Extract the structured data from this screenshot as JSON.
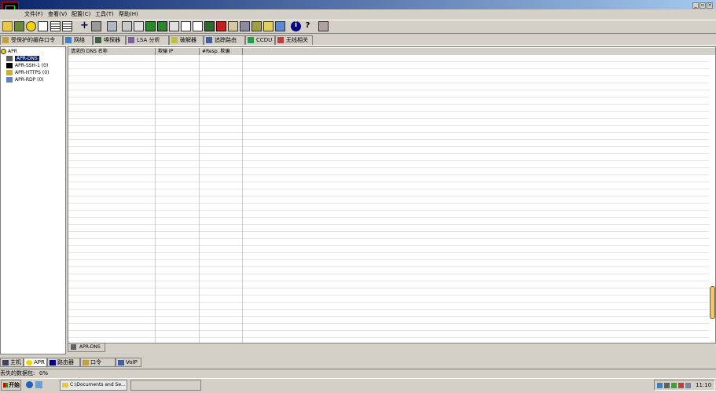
{
  "menubar": {
    "items": [
      "文件(F)",
      "查看(V)",
      "配置(C)",
      "工具(T)",
      "帮助(H)"
    ]
  },
  "toolbar": {
    "icons": [
      "open-icon",
      "save-icon",
      "radioactive-icon",
      "network-icon",
      "grid-icon",
      "list-icon",
      "plus-icon",
      "bin-icon",
      "netgraph-icon",
      "arrow-icon",
      "hash-icon",
      "hash2-icon",
      "wave-icon",
      "chart-icon",
      "dots-icon",
      "mail-icon",
      "card-icon",
      "sheet-icon",
      "cert-icon",
      "lock-icon",
      "db-icon",
      "key-icon",
      "info-icon",
      "question-icon",
      "tower-icon"
    ]
  },
  "main_tabs": [
    {
      "label": "受保护的缓存口令",
      "icon": "key-icon"
    },
    {
      "label": "网络",
      "icon": "network-icon"
    },
    {
      "label": "嗅探器",
      "icon": "sniffer-icon"
    },
    {
      "label": "LSA 分析",
      "icon": "lsa-icon"
    },
    {
      "label": "破解器",
      "icon": "cracker-icon"
    },
    {
      "label": "追踪路由",
      "icon": "traceroute-icon"
    },
    {
      "label": "CCDU",
      "icon": "ccdu-icon"
    },
    {
      "label": "无线相关",
      "icon": "wireless-icon"
    }
  ],
  "tree": {
    "root": "APR",
    "items": [
      {
        "label": "APR-DNS",
        "selected": true
      },
      {
        "label": "APR-SSH-1 (0)"
      },
      {
        "label": "APR-HTTPS (0)"
      },
      {
        "label": "APR-RDP (0)"
      }
    ]
  },
  "table": {
    "columns": [
      "请求的 DNS 名称",
      "欺骗 IP",
      "#Resp. 欺骗",
      ""
    ]
  },
  "inner_tab": {
    "label": "APR-DNS"
  },
  "bottom_tabs": [
    {
      "label": "主机",
      "icon": "host-icon"
    },
    {
      "label": "APR",
      "icon": "radioactive-icon"
    },
    {
      "label": "路由器",
      "icon": "router-icon"
    },
    {
      "label": "口令",
      "icon": "password-icon"
    },
    {
      "label": "VoIP",
      "icon": "voip-icon"
    }
  ],
  "status": {
    "label": "丢失的数据包:",
    "value": "0%"
  },
  "taskbar": {
    "start": "开始",
    "task": "C:\\Documents and Se...",
    "clock": "11:10"
  },
  "window_controls": [
    "_",
    "▫",
    "×"
  ]
}
